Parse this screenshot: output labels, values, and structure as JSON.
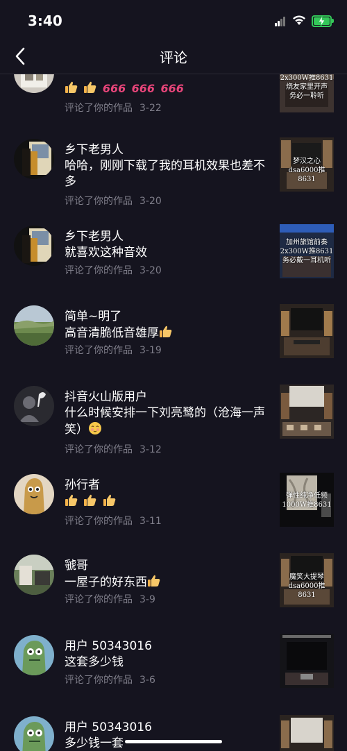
{
  "status_bar": {
    "time": "3:40"
  },
  "nav": {
    "title": "评论"
  },
  "comments": [
    {
      "username": "",
      "text": "",
      "action": "评论了你的作品",
      "date": "3-22",
      "thumb_caption": [
        "2x300W推8631",
        "烧友家里开声",
        "务必一聆听"
      ]
    },
    {
      "username": "乡下老男人",
      "text": "哈哈，刚刚下载了我的耳机效果也差不多",
      "action": "评论了你的作品",
      "date": "3-20",
      "thumb_caption": [
        "梦汉之心",
        "dsa6000推8631"
      ]
    },
    {
      "username": "乡下老男人",
      "text": "就喜欢这种音效",
      "action": "评论了你的作品",
      "date": "3-20",
      "thumb_caption": [
        "加州旅馆前奏",
        "2x300W推8631",
        "务必戴一耳机听"
      ]
    },
    {
      "username": "简单~明了",
      "text": "高音清脆低音雄厚",
      "action": "评论了你的作品",
      "date": "3-19",
      "thumb_caption": []
    },
    {
      "username": "抖音火山版用户",
      "text": "什么时候安排一下刘亮鹭的（沧海一声笑）",
      "action": "评论了你的作品",
      "date": "3-12",
      "thumb_caption": []
    },
    {
      "username": "孙行者",
      "text": "",
      "action": "评论了你的作品",
      "date": "3-11",
      "thumb_caption": [
        "弹性纯净低频",
        "1000W推8631"
      ]
    },
    {
      "username": "虢哥",
      "text": "一屋子的好东西",
      "action": "评论了你的作品",
      "date": "3-9",
      "thumb_caption": [
        "魔笑大提琴",
        "dsa6000推8631"
      ]
    },
    {
      "username": "用户 50343016",
      "text": "这套多少钱",
      "action": "评论了你的作品",
      "date": "3-6",
      "thumb_caption": []
    },
    {
      "username": "用户 50343016",
      "text": "多少钱一套",
      "action": "",
      "date": "",
      "thumb_caption": []
    }
  ],
  "emojis": {
    "thumbs_up": "thumbs-up-icon",
    "six": "666",
    "blush": "blushing-face-icon"
  },
  "colors": {
    "background": "#15141f",
    "secondary_text": "#7f7e8a",
    "six_color": "#e8457a",
    "battery": "#34c759"
  }
}
